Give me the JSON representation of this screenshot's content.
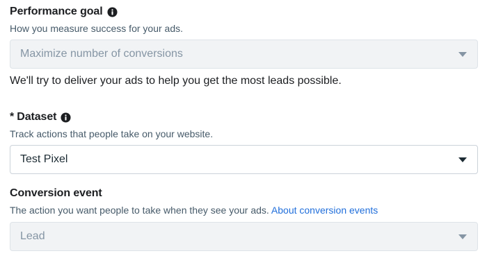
{
  "performance_goal": {
    "title": "Performance goal",
    "description": "How you measure success for your ads.",
    "selected": "Maximize number of conversions",
    "note": "We'll try to deliver your ads to help you get the most leads possible."
  },
  "dataset": {
    "required_marker": "*",
    "title": "Dataset",
    "description": "Track actions that people take on your website.",
    "selected": "Test Pixel"
  },
  "conversion_event": {
    "title": "Conversion event",
    "description": "The action you want people to take when they see your ads.",
    "link_label": "About conversion events",
    "selected": "Lead"
  },
  "icons": {
    "info": "info-icon",
    "caret": "caret-down-icon"
  },
  "colors": {
    "link": "#216fdb",
    "disabled_bg": "#f1f3f5",
    "text": "#1c1e21"
  }
}
